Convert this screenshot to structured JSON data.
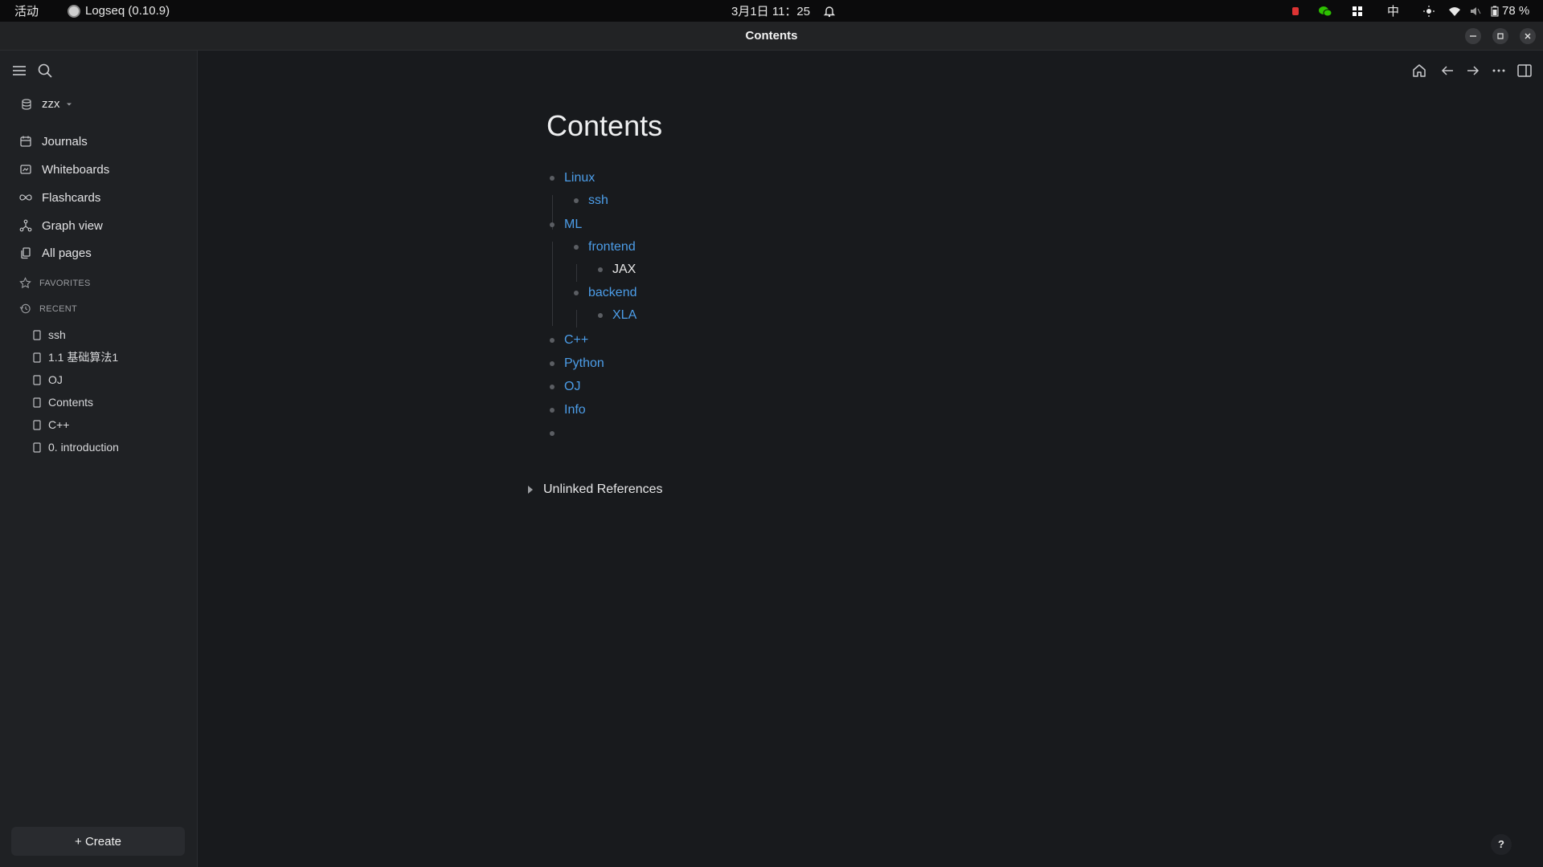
{
  "system_bar": {
    "activities": "活动",
    "app_name": "Logseq (0.10.9)",
    "datetime": "3月1日 11：25",
    "input_method": "中",
    "battery": "78 %"
  },
  "window": {
    "title": "Contents"
  },
  "sidebar": {
    "graph_name": "zzx",
    "nav": [
      {
        "label": "Journals",
        "icon": "calendar-icon"
      },
      {
        "label": "Whiteboards",
        "icon": "whiteboard-icon"
      },
      {
        "label": "Flashcards",
        "icon": "infinity-icon"
      },
      {
        "label": "Graph view",
        "icon": "graph-icon"
      },
      {
        "label": "All pages",
        "icon": "pages-icon"
      }
    ],
    "favorites_label": "FAVORITES",
    "recent_label": "RECENT",
    "recent": [
      "ssh",
      "1.1 基础算法1",
      "OJ",
      "Contents",
      "C++",
      "0. introduction"
    ],
    "create_label": "+ Create"
  },
  "page": {
    "title": "Contents",
    "blocks": [
      {
        "text": "Linux",
        "link": true,
        "level": 0
      },
      {
        "text": "ssh",
        "link": true,
        "level": 1
      },
      {
        "text": "ML",
        "link": true,
        "level": 0
      },
      {
        "text": "frontend",
        "link": true,
        "level": 1
      },
      {
        "text": "JAX",
        "link": false,
        "level": 2
      },
      {
        "text": "backend",
        "link": true,
        "level": 1
      },
      {
        "text": "XLA",
        "link": true,
        "level": 2
      },
      {
        "text": "C++",
        "link": true,
        "level": 0
      },
      {
        "text": "Python",
        "link": true,
        "level": 0
      },
      {
        "text": "OJ",
        "link": true,
        "level": 0
      },
      {
        "text": "Info",
        "link": true,
        "level": 0
      },
      {
        "text": "",
        "link": false,
        "level": 0
      }
    ],
    "unlinked_references": "Unlinked References",
    "help": "?"
  },
  "colors": {
    "link": "#4c9de8",
    "background": "#181a1d",
    "sidebar": "#1f2124"
  }
}
